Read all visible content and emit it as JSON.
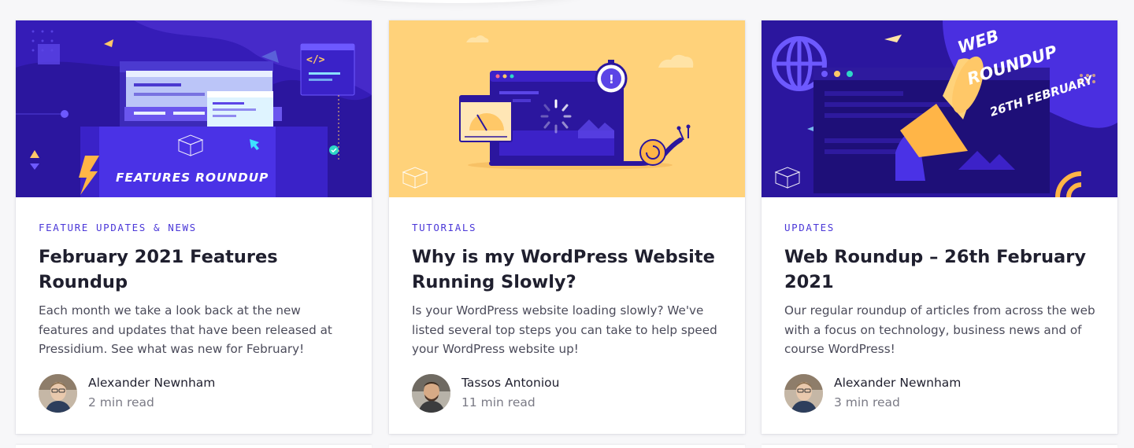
{
  "posts": [
    {
      "category": "FEATURE UPDATES & NEWS",
      "title": "February 2021 Features Roundup",
      "excerpt": "Each month we take a look back at the new features and updates that have been released at Pressidium. See what was new for February!",
      "author": "Alexander Newnham",
      "read_time": "2 min read",
      "image_text": "FEATURES ROUNDUP",
      "image_code_tag": "</>"
    },
    {
      "category": "TUTORIALS",
      "title": "Why is my WordPress Website Running Slowly?",
      "excerpt": "Is your WordPress website loading slowly? We've listed several top steps you can take to help speed your WordPress website up!",
      "author": "Tassos Antoniou",
      "read_time": "11 min read",
      "image_alert": "!"
    },
    {
      "category": "UPDATES",
      "title": "Web Roundup – 26th February 2021",
      "excerpt": "Our regular roundup of articles from across the web with a focus on technology, business news and of course WordPress!",
      "author": "Alexander Newnham",
      "read_time": "3 min read",
      "image_text_line1": "WEB",
      "image_text_line2": "ROUNDUP",
      "image_text_line3": "26TH FEBRUARY"
    }
  ],
  "colors": {
    "accent": "#4b38d8",
    "deep_purple": "#2a1a9a",
    "yellow_bg": "#ffd27a",
    "blue_bg": "#3a22c8"
  }
}
